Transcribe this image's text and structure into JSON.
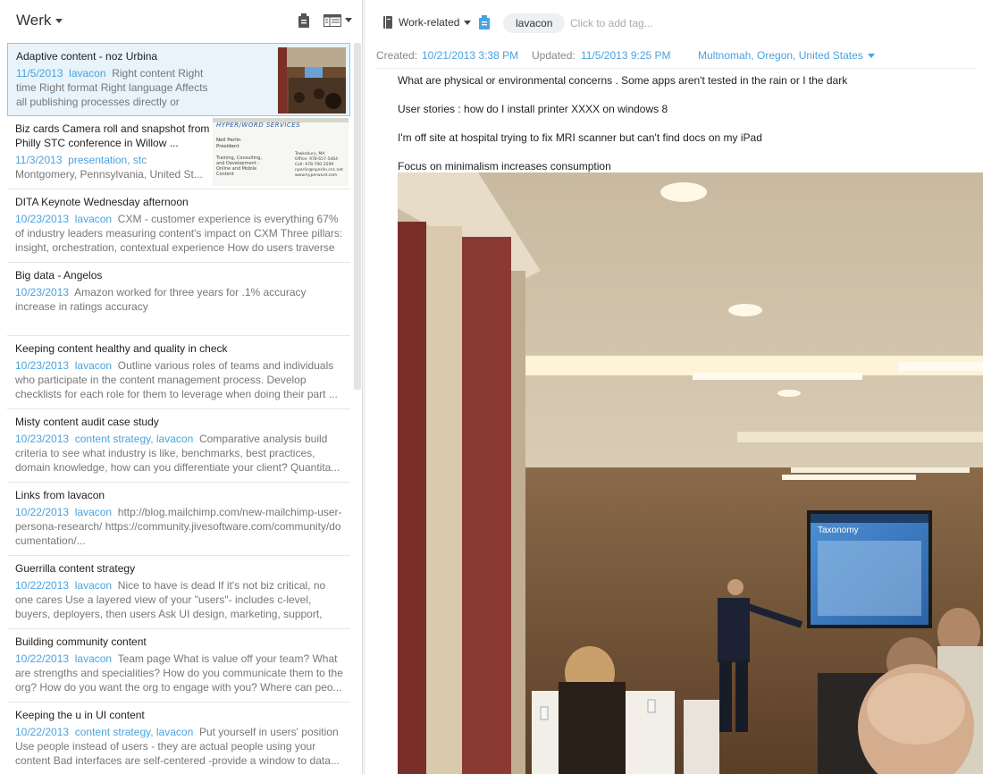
{
  "list": {
    "notebook_title": "Werk",
    "share_icon": "share-icon",
    "view_icon": "view-options-icon",
    "notes": [
      {
        "title": "Adaptive content - noz Urbina",
        "date": "11/5/2013",
        "tags": "lavacon",
        "snippet": "Right content Right time Right format Right language Affects all publishing processes directly or indirectly Adaptive design - det..."
      },
      {
        "title": "Biz cards Camera roll and snapshot from Philly STC conference in Willow ...",
        "date": "11/3/2013",
        "tags": "presentation, stc",
        "snippet": "",
        "location": "Montgomery, Pennsylvania, United St..."
      },
      {
        "title": "DITA Keynote Wednesday afternoon",
        "date": "10/23/2013",
        "tags": "lavacon",
        "snippet": "CXM - customer experience is everything 67% of industry leaders measuring content's impact on CXM Three pillars: insight, orchestration, contextual experience How do users traverse ..."
      },
      {
        "title": "Big data - Angelos",
        "date": "10/23/2013",
        "tags": "",
        "snippet": "Amazon worked for three years for .1% accuracy increase in ratings accuracy"
      },
      {
        "title": "Keeping content healthy and quality in check",
        "date": "10/23/2013",
        "tags": "lavacon",
        "snippet": "Outline various roles of teams and individuals who participate in the content management process. Develop checklists for each role for them to leverage when doing their part ..."
      },
      {
        "title": "Misty content audit case study",
        "date": "10/23/2013",
        "tags": "content strategy, lavacon",
        "snippet": "Comparative analysis build criteria to see what industry is like, benchmarks, best practices, domain knowledge, how can you differentiate your client? Quantita..."
      },
      {
        "title": "Links from lavacon",
        "date": "10/22/2013",
        "tags": "lavacon",
        "snippet": "http://blog.mailchimp.com/new-mailchimp-user-persona-research/ https://community.jivesoftware.com/community/documentation/..."
      },
      {
        "title": "Guerrilla content strategy",
        "date": "10/22/2013",
        "tags": "lavacon",
        "snippet": "Nice to have is dead If it's not biz critical, no one cares Use a layered view of your \"users\"- includes c-level, buyers, deployers, then users Ask UI design, marketing, support, Can't contr..."
      },
      {
        "title": "Building community content",
        "date": "10/22/2013",
        "tags": "lavacon",
        "snippet": "Team page What is value off your team? What are strengths and specialities? How do you communicate them to the org? How do you want the org to engage with you? Where can peo..."
      },
      {
        "title": "Keeping the u in UI content",
        "date": "10/22/2013",
        "tags": "content strategy, lavacon",
        "snippet": "Put yourself in users' position Use people instead of users - they are actual people using your content Bad interfaces are self-centered -provide a window to data..."
      }
    ],
    "card": {
      "company": "HYPER/WORD SERVICES",
      "name": "Neil Perlin",
      "role": "President",
      "services": [
        "Training, Consulting,",
        "and Development -",
        "Online and Mobile",
        "Content"
      ],
      "city": "Tewksbury, MA",
      "office": "Office: 978-657-5464",
      "cell": "Cell: 978-790-3599",
      "email": "nperlin@nperlin.cnc.net",
      "web": "www.hyperword.com"
    }
  },
  "editor": {
    "notebook_icon": "notebook-icon",
    "notebook_name": "Work-related",
    "tag_icon": "tag-icon",
    "tag": "lavacon",
    "tag_placeholder": "Click to add tag...",
    "created_label": "Created:",
    "created_value": "10/21/2013 3:38 PM",
    "updated_label": "Updated:",
    "updated_value": "11/5/2013 9:25 PM",
    "location": "Multnomah, Oregon, United States",
    "paragraphs": [
      "What are physical or environmental concerns . Some apps aren't tested in the rain or I the dark",
      "User stories : how do I install printer XXXX on windows 8",
      "I'm off site at hospital trying to fix MRI scanner but can't find docs on my iPad",
      "Focus on minimalism increases consumption"
    ],
    "slide_title": "Taxonomy"
  }
}
